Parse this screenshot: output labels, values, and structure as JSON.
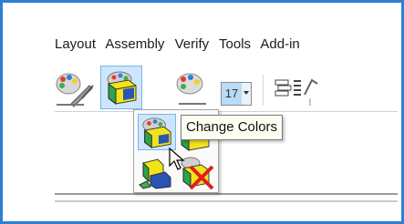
{
  "menu": {
    "items": [
      "Layout",
      "Assembly",
      "Verify",
      "Tools",
      "Add-in"
    ],
    "overflow": "s"
  },
  "toolbar": {
    "buttons": [
      {
        "name": "edit-colors-icon"
      },
      {
        "name": "change-colors-button",
        "selected": true
      },
      {
        "name": "palette-icon"
      },
      {
        "name": "color-index-spinner",
        "value": "17"
      },
      {
        "name": "layers-icon"
      },
      {
        "name": "partial-icon"
      }
    ]
  },
  "flyout": {
    "items": [
      {
        "name": "change-colors-icon",
        "highlighted": true
      },
      {
        "name": "color-part-icon"
      },
      {
        "name": "color-assembly-icon"
      },
      {
        "name": "remove-color-icon"
      }
    ]
  },
  "tooltip": {
    "text": "Change Colors"
  },
  "colors": {
    "frame": "#2e7fd4",
    "highlight": "#cde6fb",
    "highlight_border": "#77b6ea"
  }
}
